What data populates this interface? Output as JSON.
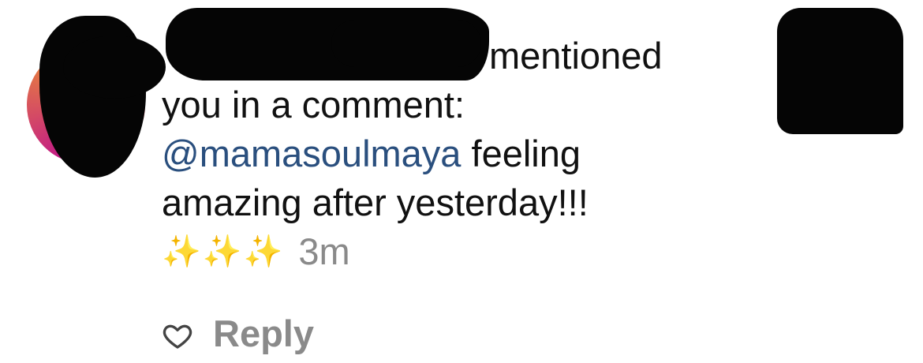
{
  "notification": {
    "username_redacted": true,
    "action_text": "mentioned",
    "line2": "you in a comment:",
    "mention": "@mamasoulmaya",
    "comment_after_mention": " feeling",
    "comment_line2": "amazing after yesterday!!!",
    "sparkles": "✨✨✨",
    "time": "3m",
    "reply_label": "Reply"
  },
  "icons": {
    "like": "heart-outline-icon",
    "emoji": "sparkles-emoji"
  },
  "colors": {
    "mention": "#2a4f7e",
    "secondary_text": "#8a8a8a",
    "redaction": "#050505",
    "avatar_ring": [
      "#f5a623",
      "#e23d70",
      "#c1168a"
    ]
  }
}
